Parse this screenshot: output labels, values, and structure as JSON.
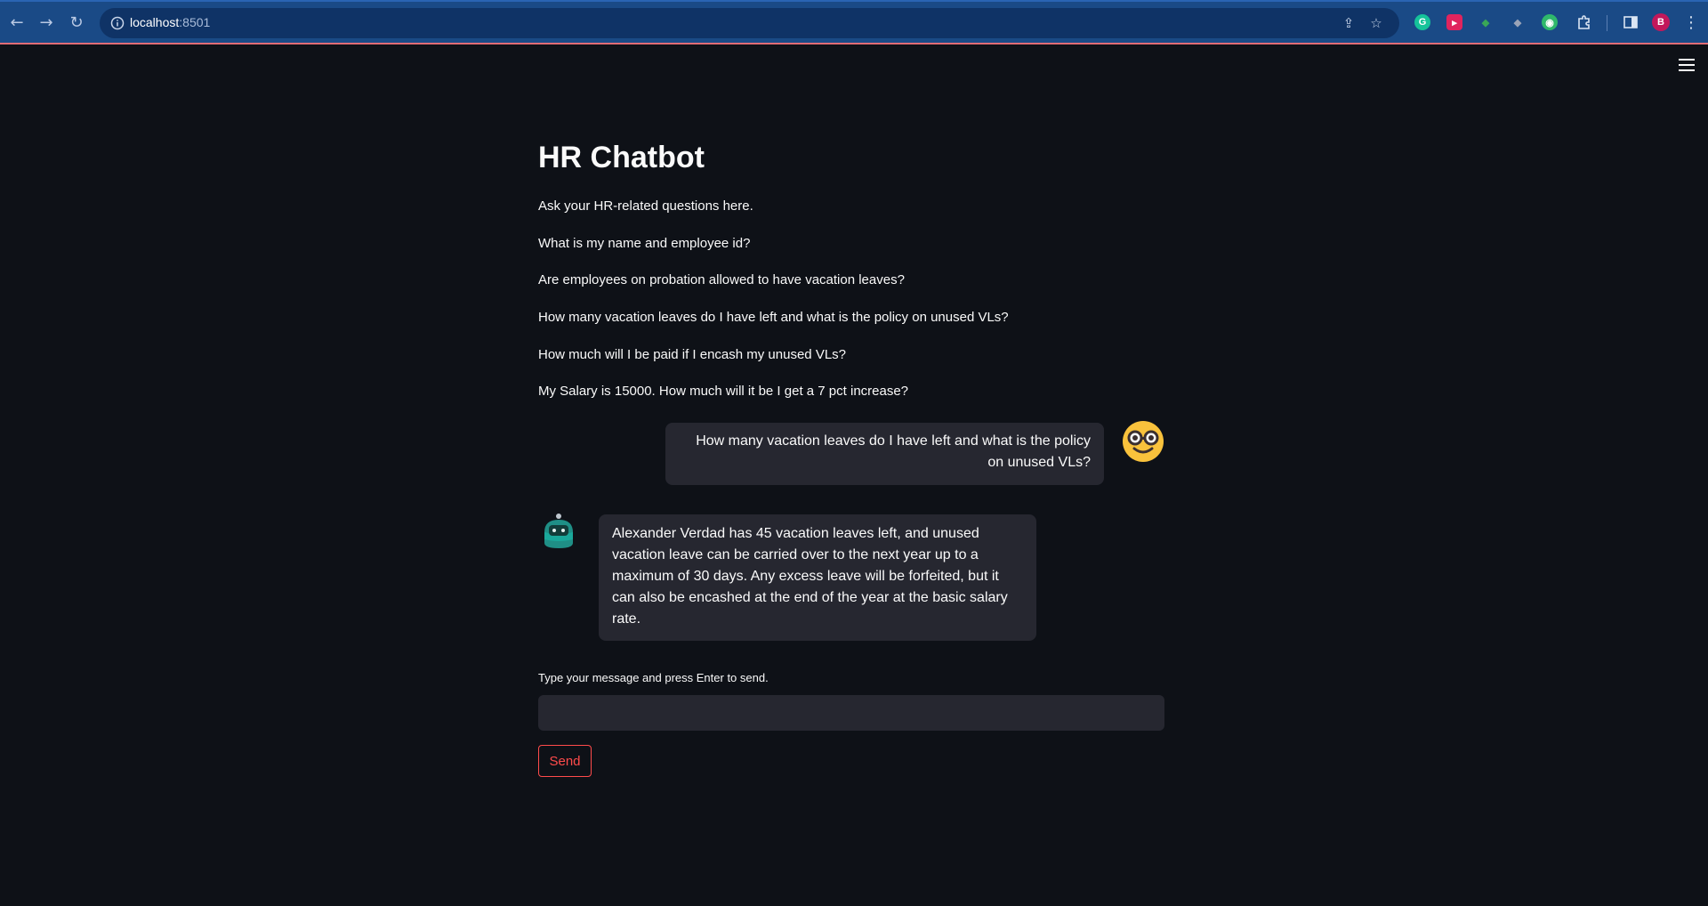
{
  "browser": {
    "url_host": "localhost",
    "url_port": ":8501",
    "profile_initial": "B",
    "extensions": [
      {
        "name": "grammarly",
        "letter": "G",
        "color": "#15c39a"
      },
      {
        "name": "video-ext",
        "letter": "▸",
        "color": "#e0245e"
      },
      {
        "name": "green-ext",
        "letter": "◆",
        "color": "#3aa757"
      },
      {
        "name": "arrow-ext",
        "letter": "◆",
        "color": "#9aa4b8"
      },
      {
        "name": "robot-ext",
        "letter": "◉",
        "color": "#2fb86b"
      }
    ]
  },
  "app": {
    "title": "HR Chatbot",
    "intro": "Ask your HR-related questions here.",
    "sample_questions": [
      "What is my name and employee id?",
      "Are employees on probation allowed to have vacation leaves?",
      "How many vacation leaves do I have left and what is the policy on unused VLs?",
      "How much will I be paid if I encash my unused VLs?",
      "My Salary is 15000. How much will it be I get a 7 pct increase?"
    ],
    "messages": {
      "user": "How many vacation leaves do I have left and what is the policy on unused VLs?",
      "bot": "Alexander Verdad has 45 vacation leaves left, and unused vacation leave can be carried over to the next year up to a maximum of 30 days. Any excess leave will be forfeited, but it can also be encashed at the end of the year at the basic salary rate."
    },
    "input_label": "Type your message and press Enter to send.",
    "input_value": "",
    "send_label": "Send",
    "accent_color": "#ff4b4b",
    "background_color": "#0e1117"
  }
}
